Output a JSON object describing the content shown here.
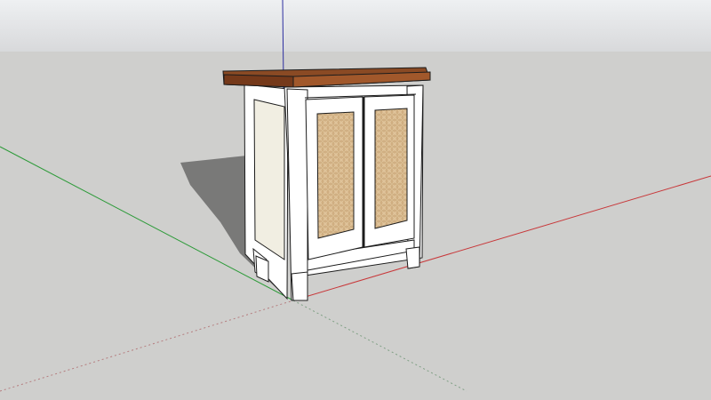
{
  "app": {
    "type": "3d-modeling-viewport"
  },
  "scene": {
    "sky_color": "#e6e7e8",
    "ground_color": "#cfcfcd",
    "axis_colors": {
      "red": "#c8383a",
      "green": "#2e9b3a",
      "blue": "#2d2fa0"
    },
    "model": {
      "object": "cabinet",
      "top_color": "#8a4a24",
      "frame_color": "#ffffff",
      "side_panel_color": "#f1eee2",
      "door_panel_color": "#d8b98e",
      "shadow_color": "#6f6f6f"
    }
  }
}
